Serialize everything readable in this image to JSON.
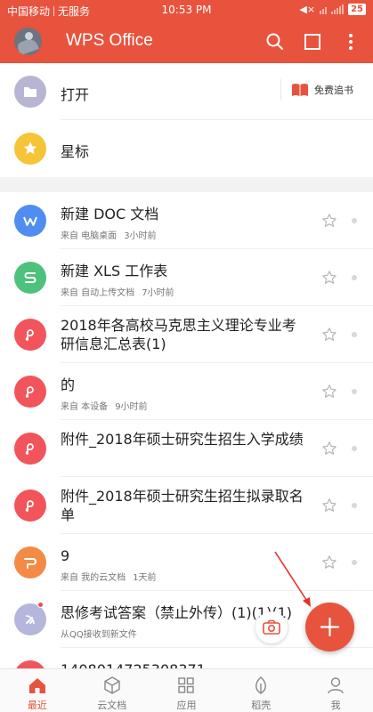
{
  "status_bar": {
    "carrier": "中国移动",
    "service": "无服务",
    "time": "10:53 PM",
    "battery": "25"
  },
  "app_bar": {
    "title": "WPS Office",
    "icons": [
      "avatar",
      "search-icon",
      "square-icon",
      "more-vertical-icon"
    ]
  },
  "quick": {
    "open_label": "打开",
    "star_label": "星标",
    "free_book_label": "免费追书"
  },
  "colors": {
    "brand": "#e8533e",
    "open_icon_bg": "#b7b5d3",
    "star_icon_bg": "#f5c437",
    "doc_blue": "#4f8ef0",
    "doc_green": "#4ec27d",
    "doc_red": "#f2545b",
    "doc_orange": "#f38b46",
    "doc_purple": "#b4b6dc"
  },
  "documents": [
    {
      "title": "新建 DOC 文档",
      "source": "来自 电脑桌面",
      "time": "3小时前",
      "icon": "word-icon"
    },
    {
      "title": "新建 XLS 工作表",
      "source": "来自 自动上传文档",
      "time": "7小时前",
      "icon": "spreadsheet-icon"
    },
    {
      "title": "2018年各高校马克思主义理论专业考研信息汇总表(1)",
      "source": "",
      "time": "",
      "icon": "pdf-icon"
    },
    {
      "title": "的",
      "source": "来自 本设备",
      "time": "9小时前",
      "icon": "pdf-icon"
    },
    {
      "title": "附件_2018年硕士研究生招生入学成绩",
      "source": "",
      "time": "",
      "icon": "pdf-icon"
    },
    {
      "title": "附件_2018年硕士研究生招生拟录取名单",
      "source": "",
      "time": "",
      "icon": "pdf-icon"
    },
    {
      "title": "9",
      "source": "来自 我的云文档",
      "time": "1天前",
      "icon": "presentation-icon"
    },
    {
      "title": "思修考试答案（禁止外传）(1)(1)(1)",
      "source": "从QQ接收到新文件",
      "time": "",
      "icon": "qq-file-icon"
    },
    {
      "title": "1408014725308371",
      "source": "",
      "time": "",
      "icon": "pdf-icon"
    }
  ],
  "bottom_nav": [
    {
      "label": "最近",
      "icon": "home-icon",
      "active": true
    },
    {
      "label": "云文档",
      "icon": "cloud-box-icon",
      "active": false
    },
    {
      "label": "应用",
      "icon": "apps-grid-icon",
      "active": false
    },
    {
      "label": "稻壳",
      "icon": "leaf-icon",
      "active": false
    },
    {
      "label": "我",
      "icon": "person-icon",
      "active": false
    }
  ],
  "fabs": {
    "camera": "camera-icon",
    "add": "plus-icon"
  }
}
